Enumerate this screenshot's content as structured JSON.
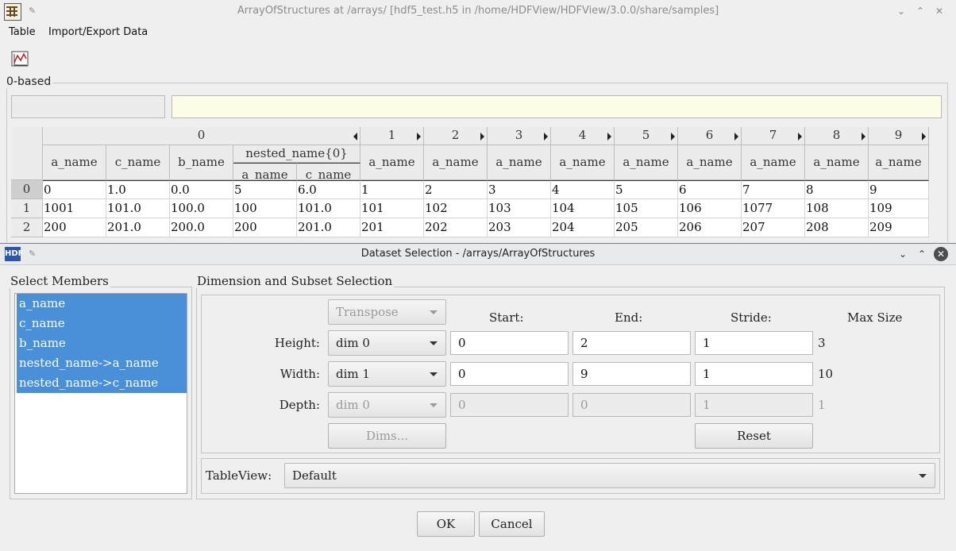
{
  "main_window": {
    "title": "ArrayOfStructures at /arrays/ [hdf5_test.h5 in /home/HDFView/HDFView/3.0.0/share/samples]"
  },
  "menubar": {
    "items": [
      "Table",
      "Import/Export Data"
    ]
  },
  "toolbar": {
    "chart_icon": "line-chart-icon"
  },
  "index_base_label": "0-based",
  "table": {
    "top_headers": [
      "0",
      "1",
      "2",
      "3",
      "4",
      "5",
      "6",
      "7",
      "8",
      "9"
    ],
    "sub_headers": [
      "a_name",
      "c_name",
      "b_name",
      "nested_name{0}",
      "a_name",
      "a_name",
      "a_name",
      "a_name",
      "a_name",
      "a_name",
      "a_name",
      "a_name",
      "a_name"
    ],
    "nested_sub_headers": [
      "a_name",
      "c_name"
    ],
    "row_headers": [
      "0",
      "1",
      "2"
    ],
    "rows": [
      [
        "0",
        "1.0",
        "0.0",
        "5",
        "6.0",
        "1",
        "2",
        "3",
        "4",
        "5",
        "6",
        "7",
        "8",
        "9"
      ],
      [
        "1001",
        "101.0",
        "100.0",
        "100",
        "101.0",
        "101",
        "102",
        "103",
        "104",
        "105",
        "106",
        "1077",
        "108",
        "109"
      ],
      [
        "200",
        "201.0",
        "200.0",
        "200",
        "201.0",
        "201",
        "202",
        "203",
        "204",
        "205",
        "206",
        "207",
        "208",
        "209"
      ]
    ]
  },
  "dialog": {
    "title": "Dataset Selection - /arrays/ArrayOfStructures",
    "select_members": {
      "label": "Select Members",
      "items": [
        "a_name",
        "c_name",
        "b_name",
        "nested_name->a_name",
        "nested_name->c_name"
      ]
    },
    "dimension": {
      "label": "Dimension and Subset Selection",
      "transpose": "Transpose",
      "col_headers": {
        "start": "Start:",
        "end": "End:",
        "stride": "Stride:",
        "max": "Max Size"
      },
      "rows": [
        {
          "label": "Height:",
          "dim": "dim 0",
          "start": "0",
          "end": "2",
          "stride": "1",
          "max": "3"
        },
        {
          "label": "Width:",
          "dim": "dim 1",
          "start": "0",
          "end": "9",
          "stride": "1",
          "max": "10"
        },
        {
          "label": "Depth:",
          "dim": "dim 0",
          "start": "0",
          "end": "0",
          "stride": "1",
          "max": "1"
        }
      ],
      "dims_button": "Dims...",
      "reset_button": "Reset"
    },
    "tableview": {
      "label": "TableView:",
      "value": "Default"
    },
    "ok_button": "OK",
    "cancel_button": "Cancel"
  }
}
